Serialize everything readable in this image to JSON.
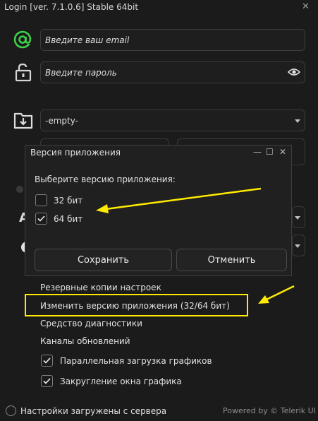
{
  "window": {
    "title": "Login [ver. 7.1.0.6] Stable 64bit",
    "close_glyph": "✕"
  },
  "login": {
    "email_placeholder": "Введите ваш email",
    "password_placeholder": "Введите пароль",
    "folder_value": "-empty-",
    "accent_color": "#3fcf4a"
  },
  "background": {
    "partial_letter": "A"
  },
  "dialog": {
    "title": "Версия приложения",
    "prompt": "Выберите версию приложения:",
    "options": [
      {
        "label": "32 бит",
        "checked": false
      },
      {
        "label": "64 бит",
        "checked": true
      }
    ],
    "save_label": "Сохранить",
    "cancel_label": "Отменить",
    "controls": {
      "minimize": "—",
      "maximize": "☐",
      "close": "✕"
    }
  },
  "menu": {
    "items": [
      "Резервные копии настроек",
      "Изменить версию приложения (32/64 бит)",
      "Средство диагностики",
      "Каналы обновлений"
    ],
    "toggles": [
      {
        "label": "Параллельная загрузка графиков",
        "checked": true
      },
      {
        "label": "Закругление окна графика",
        "checked": true
      }
    ]
  },
  "status": {
    "text": "Настройки загружены с сервера",
    "powered_by": "Powered by © Telerik UI"
  },
  "annotations": {
    "highlight_color": "#ffea00"
  }
}
